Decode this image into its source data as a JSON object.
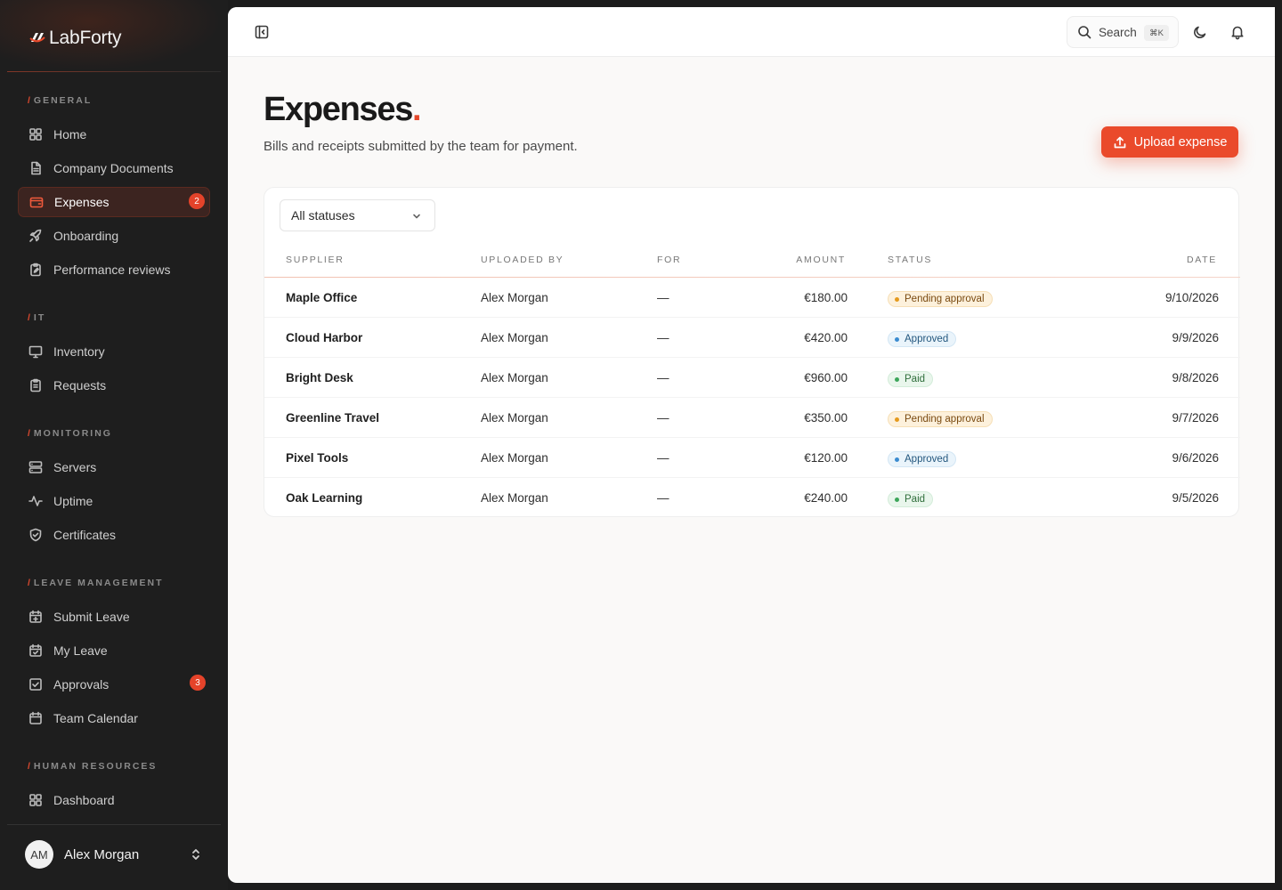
{
  "brand": {
    "name": "LabForty"
  },
  "sidebar": {
    "sections": [
      {
        "label": "GENERAL",
        "items": [
          {
            "label": "Home",
            "icon": "grid-icon"
          },
          {
            "label": "Company Documents",
            "icon": "document-icon"
          },
          {
            "label": "Expenses",
            "icon": "wallet-icon",
            "badge": "2",
            "active": true
          },
          {
            "label": "Onboarding",
            "icon": "rocket-icon"
          },
          {
            "label": "Performance reviews",
            "icon": "clipboard-edit-icon"
          }
        ]
      },
      {
        "label": "IT",
        "items": [
          {
            "label": "Inventory",
            "icon": "monitor-icon"
          },
          {
            "label": "Requests",
            "icon": "clipboard-list-icon"
          }
        ]
      },
      {
        "label": "MONITORING",
        "items": [
          {
            "label": "Servers",
            "icon": "server-icon"
          },
          {
            "label": "Uptime",
            "icon": "activity-icon"
          },
          {
            "label": "Certificates",
            "icon": "shield-check-icon"
          }
        ]
      },
      {
        "label": "LEAVE MANAGEMENT",
        "items": [
          {
            "label": "Submit Leave",
            "icon": "calendar-plus-icon"
          },
          {
            "label": "My Leave",
            "icon": "calendar-check-icon"
          },
          {
            "label": "Approvals",
            "icon": "check-square-icon",
            "badge": "3"
          },
          {
            "label": "Team Calendar",
            "icon": "calendar-icon"
          }
        ]
      },
      {
        "label": "HUMAN RESOURCES",
        "items": [
          {
            "label": "Dashboard",
            "icon": "grid-icon"
          }
        ]
      }
    ],
    "user": {
      "initials": "AM",
      "name": "Alex Morgan"
    }
  },
  "topbar": {
    "search_label": "Search",
    "search_shortcut": "⌘K"
  },
  "page": {
    "title": "Expenses",
    "title_dot": ".",
    "subtitle": "Bills and receipts submitted by the team for payment.",
    "upload_label": "Upload expense"
  },
  "filter": {
    "selected": "All statuses"
  },
  "table": {
    "columns": {
      "supplier": "SUPPLIER",
      "uploaded_by": "UPLOADED BY",
      "for": "FOR",
      "amount": "AMOUNT",
      "status": "STATUS",
      "date": "DATE"
    },
    "rows": [
      {
        "supplier": "Maple Office",
        "uploaded_by": "Alex Morgan",
        "for": "—",
        "amount": "€180.00",
        "status": "Pending approval",
        "status_kind": "pending",
        "date": "9/10/2026"
      },
      {
        "supplier": "Cloud Harbor",
        "uploaded_by": "Alex Morgan",
        "for": "—",
        "amount": "€420.00",
        "status": "Approved",
        "status_kind": "approved",
        "date": "9/9/2026"
      },
      {
        "supplier": "Bright Desk",
        "uploaded_by": "Alex Morgan",
        "for": "—",
        "amount": "€960.00",
        "status": "Paid",
        "status_kind": "paid",
        "date": "9/8/2026"
      },
      {
        "supplier": "Greenline Travel",
        "uploaded_by": "Alex Morgan",
        "for": "—",
        "amount": "€350.00",
        "status": "Pending approval",
        "status_kind": "pending",
        "date": "9/7/2026"
      },
      {
        "supplier": "Pixel Tools",
        "uploaded_by": "Alex Morgan",
        "for": "—",
        "amount": "€120.00",
        "status": "Approved",
        "status_kind": "approved",
        "date": "9/6/2026"
      },
      {
        "supplier": "Oak Learning",
        "uploaded_by": "Alex Morgan",
        "for": "—",
        "amount": "€240.00",
        "status": "Paid",
        "status_kind": "paid",
        "date": "9/5/2026"
      }
    ]
  },
  "colors": {
    "accent": "#ea4a2b",
    "sidebar_bg": "#1e1e1e",
    "page_bg": "#faf9f8"
  }
}
